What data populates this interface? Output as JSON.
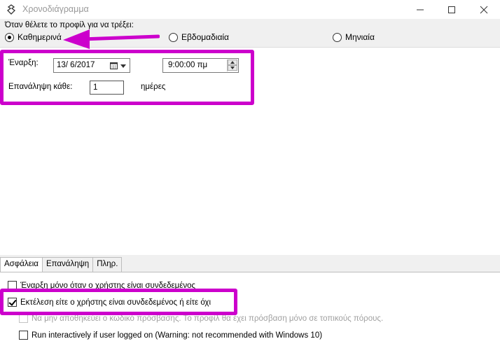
{
  "window": {
    "title": "Χρονοδιάγραμμα",
    "icon": "app-icon"
  },
  "question": {
    "label": "Όταν θέλετε το προφίλ για να τρέξει:",
    "options": [
      {
        "label": "Καθημερινά",
        "checked": true
      },
      {
        "label": "Εβδομαδιαία",
        "checked": false
      },
      {
        "label": "Μηνιαία",
        "checked": false
      }
    ]
  },
  "schedule": {
    "start_label": "Έναρξη:",
    "date_value": "13/  6/2017",
    "time_value": "9:00:00 πμ",
    "repeat_label": "Επανάληψη κάθε:",
    "repeat_value": "1",
    "repeat_unit": "ημέρες"
  },
  "tabs": [
    {
      "label": "Ασφάλεια",
      "active": true
    },
    {
      "label": "Επανάληψη",
      "active": false
    },
    {
      "label": "Πληρ.",
      "active": false
    }
  ],
  "security": {
    "opt_logged_on_only": "Έναρξη μόνο όταν ο χρήστης είναι συνδεδεμένος",
    "opt_run_whether": "Εκτέλεση είτε ο χρήστης είναι συνδεδεμένος ή είτε όχι",
    "opt_no_store_password": "Να μην αποθηκεύει ο κωδικό πρόσβασης. Το προφίλ θα έχει πρόσβαση μόνο σε τοπικούς πόρους.",
    "opt_run_interactively": "Run interactively if user logged on (Warning: not recommended with Windows 10)"
  },
  "annotation_color": "#cc00cc"
}
